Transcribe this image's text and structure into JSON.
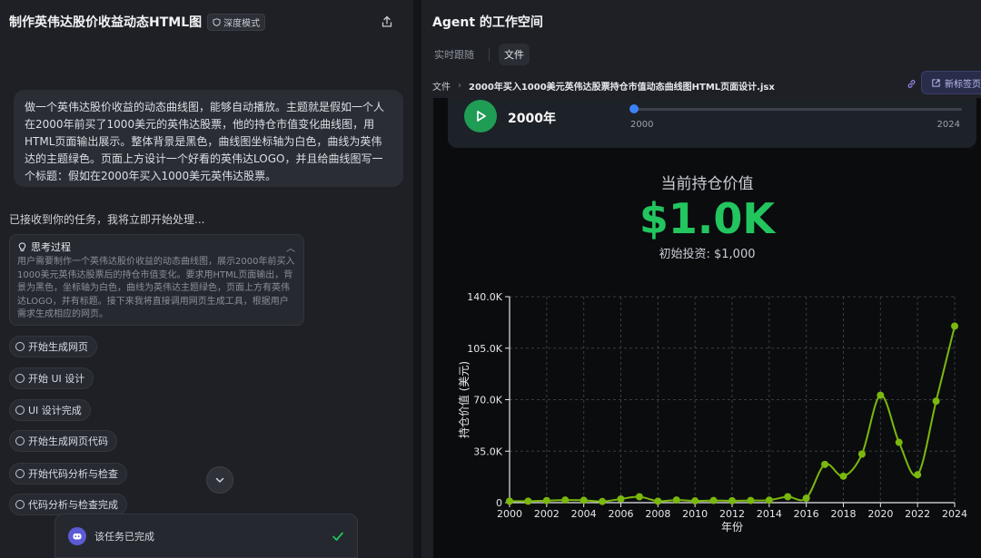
{
  "left": {
    "title": "制作英伟达股价收益动态HTML图",
    "mode_badge": "深度模式",
    "user_message": "做一个英伟达股价收益的动态曲线图，能够自动播放。主题就是假如一个人在2000年前买了1000美元的英伟达股票，他的持仓市值变化曲线图，用HTML页面输出展示。整体背景是黑色，曲线图坐标轴为白色，曲线为英伟达的主题绿色。页面上方设计一个好看的英伟达LOGO，并且给曲线图写一个标题：假如在2000年买入1000美元英伟达股票。",
    "ack": "已接收到你的任务，我将立即开始处理...",
    "thinking": {
      "title": "思考过程",
      "body": "用户需要制作一个英伟达股价收益的动态曲线图，展示2000年前买入1000美元英伟达股票后的持仓市值变化。要求用HTML页面输出，背景为黑色，坐标轴为白色，曲线为英伟达主题绿色，页面上方有英伟达LOGO，并有标题。接下来我将直接调用网页生成工具，根据用户需求生成相应的网页。"
    },
    "steps": [
      "开始生成网页",
      "开始 UI 设计",
      "UI 设计完成",
      "开始生成网页代码",
      "开始代码分析与检查",
      "代码分析与检查完成"
    ],
    "done_text": "该任务已完成"
  },
  "right": {
    "title": "Agent 的工作空间",
    "tabs": [
      "实时跟随",
      "文件"
    ],
    "active_tab": 1,
    "breadcrumb_root": "文件",
    "file_name": "2000年买入1000美元英伟达股票持仓市值动态曲线图HTML页面设计.jsx",
    "new_tab_label": "新标签页打开"
  },
  "preview": {
    "current_year": "2000年",
    "slider": {
      "min": "2000",
      "max": "2024",
      "progress": 0
    },
    "value_label": "当前持仓价值",
    "value_amount": "$1.0K",
    "initial_investment": "初始投资: $1,000"
  },
  "colors": {
    "accent_green": "#22c55e",
    "curve_green": "#7ab80e",
    "play_button": "#1f9d55",
    "slider_blue": "#3b82f6"
  },
  "chart_data": {
    "type": "line",
    "x": [
      2000,
      2001,
      2002,
      2003,
      2004,
      2005,
      2006,
      2007,
      2008,
      2009,
      2010,
      2011,
      2012,
      2013,
      2014,
      2015,
      2016,
      2017,
      2018,
      2019,
      2020,
      2021,
      2022,
      2023,
      2024
    ],
    "series": [
      {
        "values": [
          1000,
          1000,
          1400,
          1800,
          1600,
          800,
          2500,
          4000,
          1000,
          1800,
          1200,
          1500,
          1300,
          1500,
          1700,
          4000,
          3000,
          26000,
          18000,
          33000,
          73000,
          41000,
          19000,
          69000,
          120000
        ]
      }
    ],
    "xlabel": "年份",
    "ylabel": "持仓价值 (美元)",
    "xlim": [
      2000,
      2024
    ],
    "ylim": [
      0,
      140000
    ],
    "yticks": [
      "0",
      "35.0K",
      "70.0K",
      "105.0K",
      "140.0K"
    ],
    "xticks": [
      "2000",
      "2002",
      "2004",
      "2006",
      "2008",
      "2010",
      "2012",
      "2014",
      "2016",
      "2018",
      "2020",
      "2022",
      "2024"
    ],
    "grid": true
  }
}
